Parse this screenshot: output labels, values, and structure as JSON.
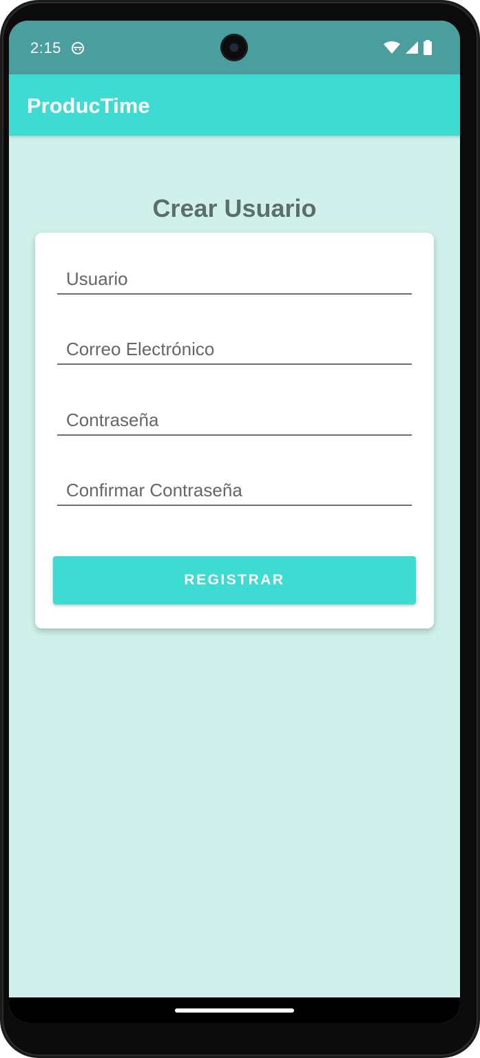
{
  "status_bar": {
    "time": "2:15",
    "app_icon": "android-debug-icon",
    "icons": [
      "wifi-icon",
      "signal-icon",
      "battery-icon"
    ],
    "color": "#4a9e9d"
  },
  "app_bar": {
    "title": "ProducTime",
    "color": "#3ddbd2"
  },
  "page": {
    "heading": "Crear Usuario",
    "background": "#d0f1eb"
  },
  "form": {
    "username": {
      "placeholder": "Usuario",
      "value": ""
    },
    "email": {
      "placeholder": "Correo Electrónico",
      "value": ""
    },
    "password": {
      "placeholder": "Contraseña",
      "value": ""
    },
    "confirm_password": {
      "placeholder": "Confirmar Contraseña",
      "value": ""
    },
    "submit_label": "REGISTRAR"
  },
  "navigation": {
    "home_indicator": "home-gesture-bar"
  }
}
